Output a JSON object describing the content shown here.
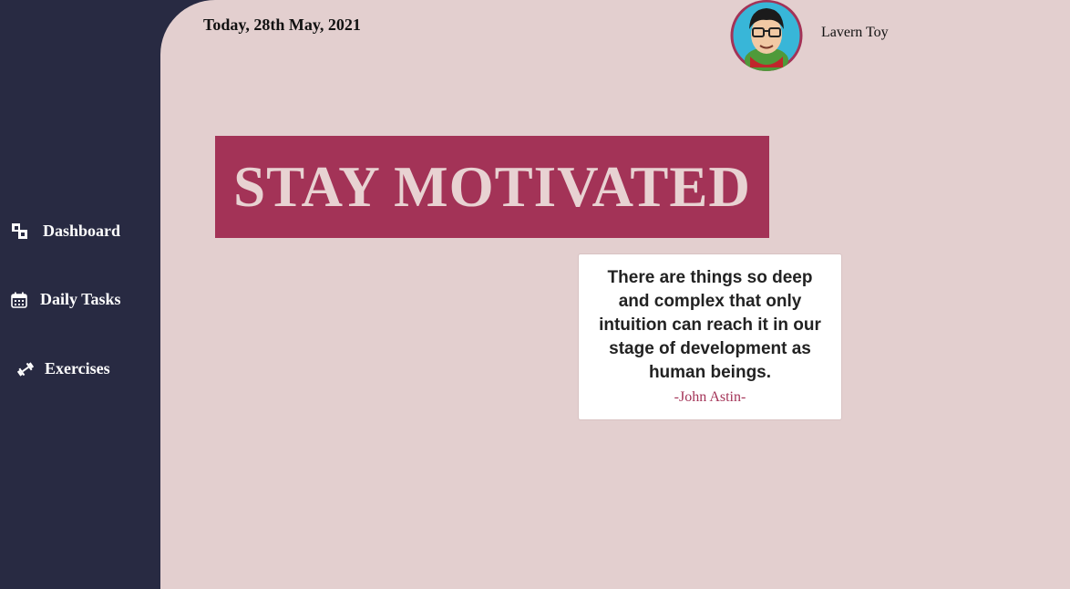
{
  "sidebar": {
    "items": [
      {
        "label": "Dashboard",
        "icon": "dashboard-icon"
      },
      {
        "label": "Daily Tasks",
        "icon": "calendar-icon"
      },
      {
        "label": "Exercises",
        "icon": "dumbbell-icon"
      }
    ]
  },
  "header": {
    "date": "Today, 28th May, 2021",
    "user_name": "Lavern Toy",
    "avatar_icon": "avatar-image"
  },
  "banner": {
    "text": "STAY MOTIVATED"
  },
  "quote": {
    "text": "There are things so deep and complex that only intuition can reach it in our stage of development as human beings.",
    "author": "-John Astin-"
  },
  "colors": {
    "sidebar_bg": "#282a42",
    "page_bg": "#e3cfcf",
    "accent": "#a33357"
  }
}
